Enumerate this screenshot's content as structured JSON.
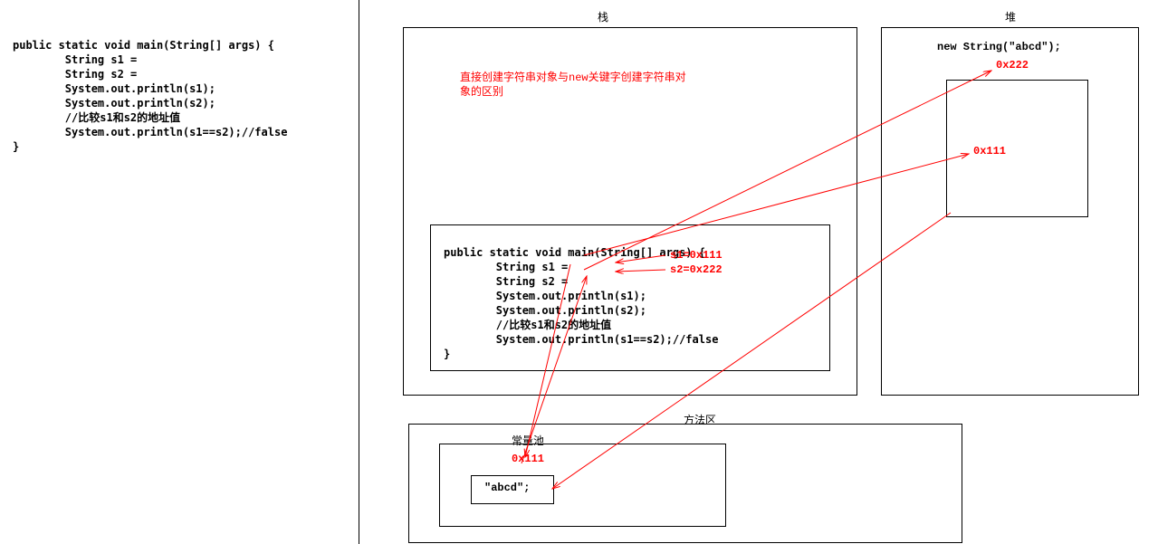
{
  "code_left": "public static void main(String[] args) {\n        String s1 =\n        String s2 =\n        System.out.println(s1);\n        System.out.println(s2);\n        //比较s1和s2的地址值\n        System.out.println(s1==s2);//false\n}",
  "labels": {
    "stack": "栈",
    "heap": "堆",
    "method_area": "方法区",
    "constant_pool": "常量池",
    "note_line1": "直接创建字符串对象与new关键字创建字符串对",
    "note_line2": "象的区别"
  },
  "heap_new_string": "new String(\"abcd\");",
  "code_stack": "public static void main(String[] args) {\n        String s1 =\n        String s2 =\n        System.out.println(s1);\n        System.out.println(s2);\n        //比较s1和s2的地址值\n        System.out.println(s1==s2);//false\n}",
  "s1_assign": "s1=0x111",
  "s2_assign": "s2=0x222",
  "addr_heap_outer": "0x222",
  "addr_heap_inner": "0x111",
  "addr_pool": "0x111",
  "pool_value": "\"abcd\";"
}
